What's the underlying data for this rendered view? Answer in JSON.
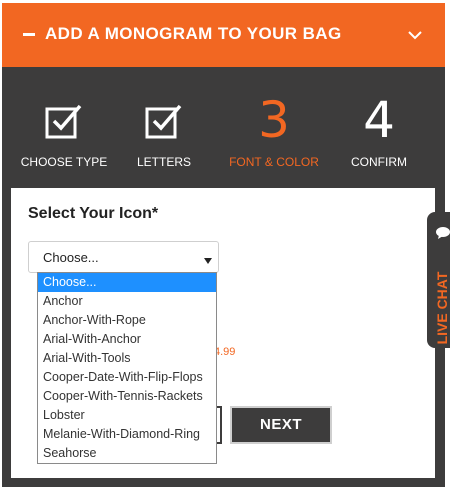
{
  "header": {
    "title": "ADD A MONOGRAM TO YOUR BAG",
    "collapse_icon": "chevron-down-icon"
  },
  "steps": [
    {
      "label": "CHOOSE TYPE",
      "icon": "checkbox-checked-icon",
      "state": "done"
    },
    {
      "label": "LETTERS",
      "icon": "checkbox-checked-icon",
      "state": "done"
    },
    {
      "label": "FONT & COLOR",
      "number": "3",
      "state": "active"
    },
    {
      "label": "CONFIRM",
      "number": "4",
      "state": "upcoming"
    }
  ],
  "form": {
    "heading": "Select Your Icon*",
    "select_value": "Choose...",
    "price_fragment": "4.99",
    "next_label": "NEXT"
  },
  "dropdown": {
    "options": [
      "Choose...",
      "Anchor",
      "Anchor-With-Rope",
      "Arial-With-Anchor",
      "Arial-With-Tools",
      "Cooper-Date-With-Flip-Flops",
      "Cooper-With-Tennis-Rackets",
      "Lobster",
      "Melanie-With-Diamond-Ring",
      "Seahorse"
    ],
    "selected": "Choose..."
  },
  "live_chat": {
    "label": "LIVE CHAT"
  },
  "colors": {
    "accent": "#f26722",
    "panel": "#3d3c3c",
    "highlight": "#1e90ff"
  }
}
